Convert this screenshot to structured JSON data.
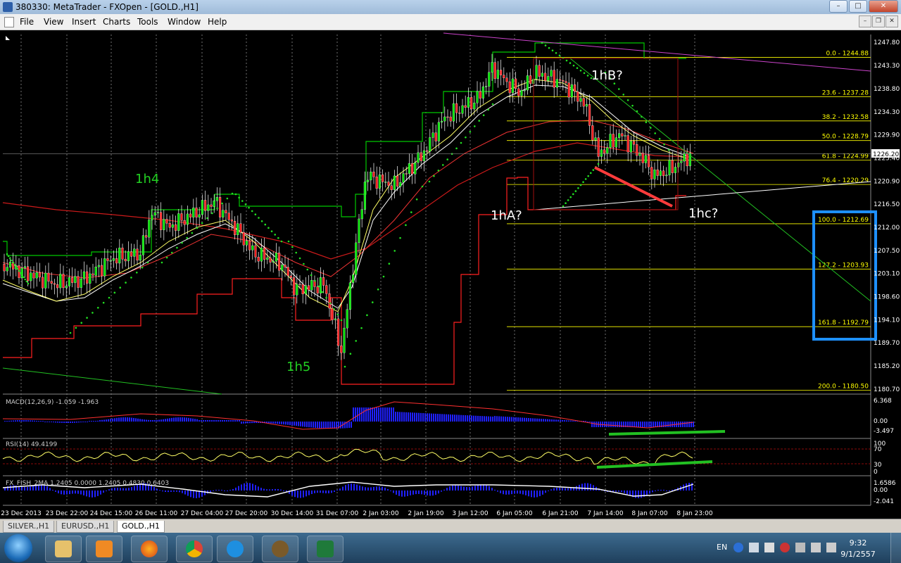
{
  "window": {
    "title": "380330: MetaTrader - FXOpen - [GOLD.,H1]",
    "buttons": {
      "minimize": "–",
      "maximize": "□",
      "close": "✕"
    }
  },
  "menu": {
    "items": [
      "File",
      "View",
      "Insert",
      "Charts",
      "Tools",
      "Window",
      "Help"
    ],
    "mdi_buttons": {
      "minimize": "–",
      "restore": "❐",
      "close": "✕"
    }
  },
  "chart": {
    "price_axis": [
      "1247.80",
      "1243.30",
      "1238.80",
      "1234.30",
      "1229.90",
      "1225.40",
      "1220.90",
      "1216.50",
      "1212.00",
      "1207.50",
      "1203.10",
      "1198.60",
      "1194.10",
      "1189.70",
      "1185.20",
      "1180.70"
    ],
    "current_price": "1226.20",
    "time_axis": [
      "23 Dec 2013",
      "23 Dec 22:00",
      "24 Dec 15:00",
      "26 Dec 11:00",
      "27 Dec 04:00",
      "27 Dec 20:00",
      "30 Dec 14:00",
      "31 Dec 07:00",
      "2 Jan 03:00",
      "2 Jan 19:00",
      "3 Jan 12:00",
      "6 Jan 05:00",
      "6 Jan 21:00",
      "7 Jan 14:00",
      "8 Jan 07:00",
      "8 Jan 23:00"
    ],
    "fib_levels": [
      {
        "label": "0.0 - 1244.88"
      },
      {
        "label": "23.6 - 1237.28"
      },
      {
        "label": "38.2 - 1232.58"
      },
      {
        "label": "50.0 - 1228.79"
      },
      {
        "label": "61.8 - 1224.99"
      },
      {
        "label": "76.4 - 1220.29"
      },
      {
        "label": "100.0 - 1212.69"
      },
      {
        "label": "127.2 - 1203.93"
      },
      {
        "label": "161.8 - 1192.79"
      },
      {
        "label": "200.0 - 1180.50"
      }
    ],
    "annotations": {
      "a": "1h4",
      "b": "1h5",
      "c": "1hA?",
      "d": "1hB?",
      "e": "1hc?"
    },
    "colors": {
      "fib": "#ffff00",
      "bull": "#00e600",
      "bear": "#ff2020",
      "highlight_box": "#1e90ff",
      "trend_red": "#ff3b3b",
      "trend_green_indicator": "#22c022",
      "magenta_line": "#cc44cc"
    }
  },
  "macd": {
    "label": "MACD(12,26,9) -1.059 -1.963",
    "axis": [
      "6.368",
      "0.00",
      "-3.497"
    ]
  },
  "rsi": {
    "label": "RSI(14) 49.4199",
    "axis": [
      "100",
      "70",
      "30",
      "0"
    ]
  },
  "fisher": {
    "label": "FX_FISH_2MA 1.2405 0.0000 1.2405 0.4830 0.6403",
    "axis": [
      "1.6586",
      "0.00",
      "-2.041"
    ]
  },
  "symbol_tabs": [
    "SILVER.,H1",
    "EURUSD.,H1",
    "GOLD.,H1"
  ],
  "taskbar": {
    "apps": [
      "file-explorer-icon",
      "media-player-icon",
      "firefox-icon",
      "chrome-icon",
      "internet-explorer-icon",
      "metatrader-icon",
      "excel-icon"
    ],
    "tray_lang": "EN",
    "clock_time": "9:32",
    "clock_date": "9/1/2557"
  }
}
